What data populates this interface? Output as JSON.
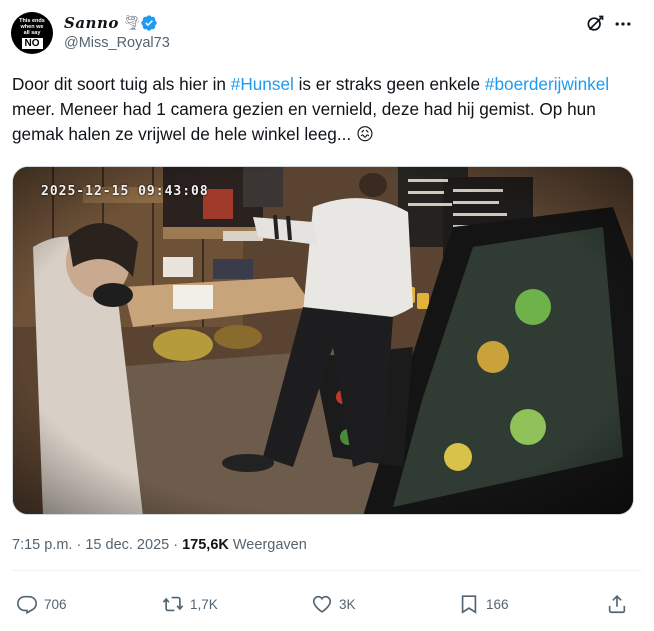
{
  "author": {
    "display_name": "Sanno",
    "name_emoji": "tornado",
    "handle": "@Miss_Royal73",
    "avatar_text_small": "This ends when we all say",
    "avatar_text_big": "NO"
  },
  "icons": {
    "verified": "verified-badge-icon",
    "grok": "grok-icon",
    "more": "more-icon",
    "reply": "reply-icon",
    "retweet": "retweet-icon",
    "like": "like-icon",
    "bookmark": "bookmark-icon",
    "share": "share-icon"
  },
  "tweet": {
    "text_1": "Door dit soort tuig als hier in ",
    "hashtag_1": "#Hunsel",
    "text_2": " is er straks geen enkele ",
    "hashtag_2": "#boerderijwinkel",
    "text_3": " meer. Meneer had 1 camera gezien en vernield, deze had hij gemist. Op hun gemak halen ze vrijwel de hele winkel leeg... ",
    "emoji": "😖"
  },
  "media": {
    "camera_timestamp": "2025-12-15 09:43:08"
  },
  "meta": {
    "time": "7:15 p.m.",
    "separator": " · ",
    "date": "15 dec. 2025",
    "views_count": "175,6K",
    "views_label": " Weergaven"
  },
  "stats": {
    "replies": "706",
    "reposts": "1,7K",
    "likes": "3K",
    "bookmarks": "166"
  },
  "colors": {
    "link": "#1d9bf0",
    "verified": "#1d9bf0",
    "secondary_text": "#536471",
    "primary_text": "#0f1419"
  }
}
